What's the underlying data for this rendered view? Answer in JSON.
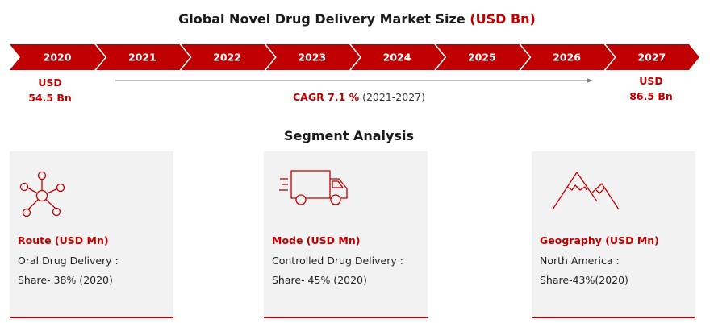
{
  "header": {
    "title_main": "Global Novel Drug Delivery Market Size",
    "title_unit": "(USD Bn)"
  },
  "chart_data": {
    "type": "table",
    "title": "Global Novel Drug Delivery Market Size (USD Bn)",
    "categories": [
      "2020",
      "2021",
      "2022",
      "2023",
      "2024",
      "2025",
      "2026",
      "2027"
    ],
    "series": [
      {
        "name": "USD",
        "points": [
          {
            "x": "2020",
            "y": 54.5
          },
          {
            "x": "2027",
            "y": 86.5
          }
        ]
      }
    ],
    "start_label": {
      "line1": "USD",
      "line2": "54.5 Bn"
    },
    "end_label": {
      "line1": "USD",
      "line2": "86.5 Bn"
    },
    "cagr": {
      "rate": "CAGR 7.1 %",
      "period": "(2021-2027)"
    },
    "colors": {
      "accent": "#c00000",
      "arrow_line": "#7f7f7f",
      "card_bg": "#f2f2f2"
    }
  },
  "segments": {
    "title": "Segment Analysis",
    "cards": [
      {
        "icon": "network-nodes-icon",
        "heading": "Route (USD Mn)",
        "line1": "Oral Drug Delivery :",
        "line2": "Share- 38% (2020)"
      },
      {
        "icon": "delivery-truck-icon",
        "heading": "Mode (USD Mn)",
        "line1": "Controlled Drug Delivery :",
        "line2": "Share- 45% (2020)"
      },
      {
        "icon": "mountain-icon",
        "heading": "Geography (USD Mn)",
        "line1": "North America :",
        "line2": "Share-43%(2020)"
      }
    ]
  }
}
